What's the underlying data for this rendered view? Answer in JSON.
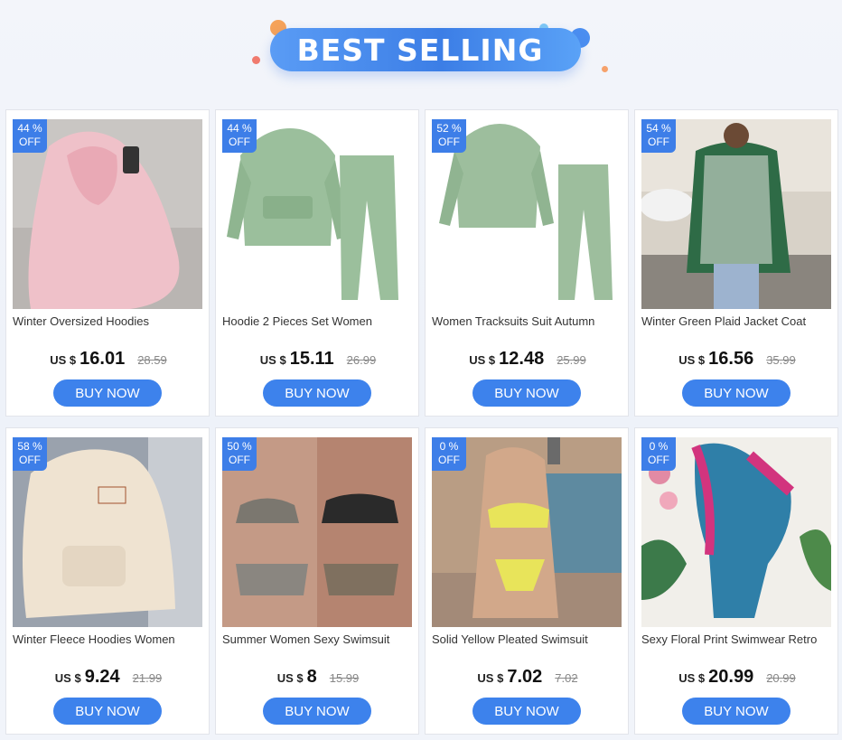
{
  "banner": {
    "title": "BEST SELLING"
  },
  "colors": {
    "accent": "#3d82ec",
    "badge": "#3d7ee8"
  },
  "products": [
    {
      "name": "Winter Oversized Hoodies",
      "discount": "44 %",
      "off": "OFF",
      "currency": "US $",
      "price": "16.01",
      "old_price": "28.59",
      "buy": "BUY NOW"
    },
    {
      "name": "Hoodie 2 Pieces Set Women",
      "discount": "44 %",
      "off": "OFF",
      "currency": "US $",
      "price": "15.11",
      "old_price": "26.99",
      "buy": "BUY NOW"
    },
    {
      "name": "Women Tracksuits Suit Autumn",
      "discount": "52 %",
      "off": "OFF",
      "currency": "US $",
      "price": "12.48",
      "old_price": "25.99",
      "buy": "BUY NOW"
    },
    {
      "name": "Winter Green Plaid Jacket Coat",
      "discount": "54 %",
      "off": "OFF",
      "currency": "US $",
      "price": "16.56",
      "old_price": "35.99",
      "buy": "BUY NOW"
    },
    {
      "name": "Winter Fleece Hoodies Women",
      "discount": "58 %",
      "off": "OFF",
      "currency": "US $",
      "price": "9.24",
      "old_price": "21.99",
      "buy": "BUY NOW"
    },
    {
      "name": "Summer Women Sexy Swimsuit",
      "discount": "50 %",
      "off": "OFF",
      "currency": "US $",
      "price": "8",
      "old_price": "15.99",
      "buy": "BUY NOW"
    },
    {
      "name": "Solid Yellow Pleated Swimsuit",
      "discount": "0 %",
      "off": "OFF",
      "currency": "US $",
      "price": "7.02",
      "old_price": "7.02",
      "buy": "BUY NOW"
    },
    {
      "name": "Sexy Floral Print Swimwear Retro",
      "discount": "0 %",
      "off": "OFF",
      "currency": "US $",
      "price": "20.99",
      "old_price": "20.99",
      "buy": "BUY NOW"
    }
  ]
}
